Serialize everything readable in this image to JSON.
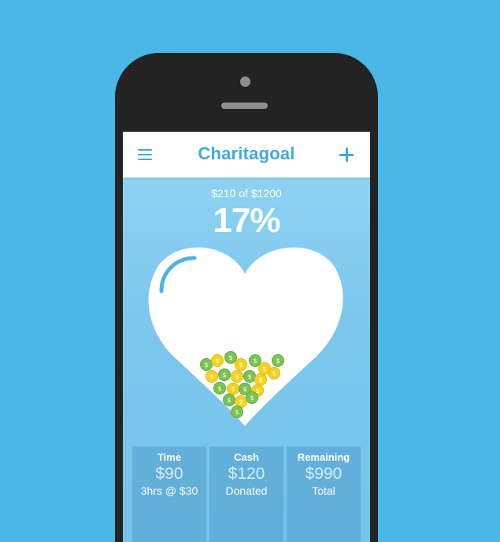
{
  "header": {
    "title": "Charitagoal",
    "menu_icon": "hamburger-menu-icon",
    "add_icon": "plus-icon"
  },
  "progress": {
    "caption": "$210 of $1200",
    "percent_label": "17%",
    "raised": 210,
    "goal": 1200,
    "fill_fraction": 0.17
  },
  "stats": [
    {
      "title": "Time",
      "value": "$90",
      "subtitle": "3hrs @ $30"
    },
    {
      "title": "Cash",
      "value": "$120",
      "subtitle": "Donated"
    },
    {
      "title": "Remaining",
      "value": "$990",
      "subtitle": "Total"
    }
  ],
  "colors": {
    "background": "#4ab8e6",
    "accent": "#3fa9e0",
    "phone": "#232323",
    "coin_green": "#7cc352",
    "coin_yellow": "#f5d31e"
  }
}
